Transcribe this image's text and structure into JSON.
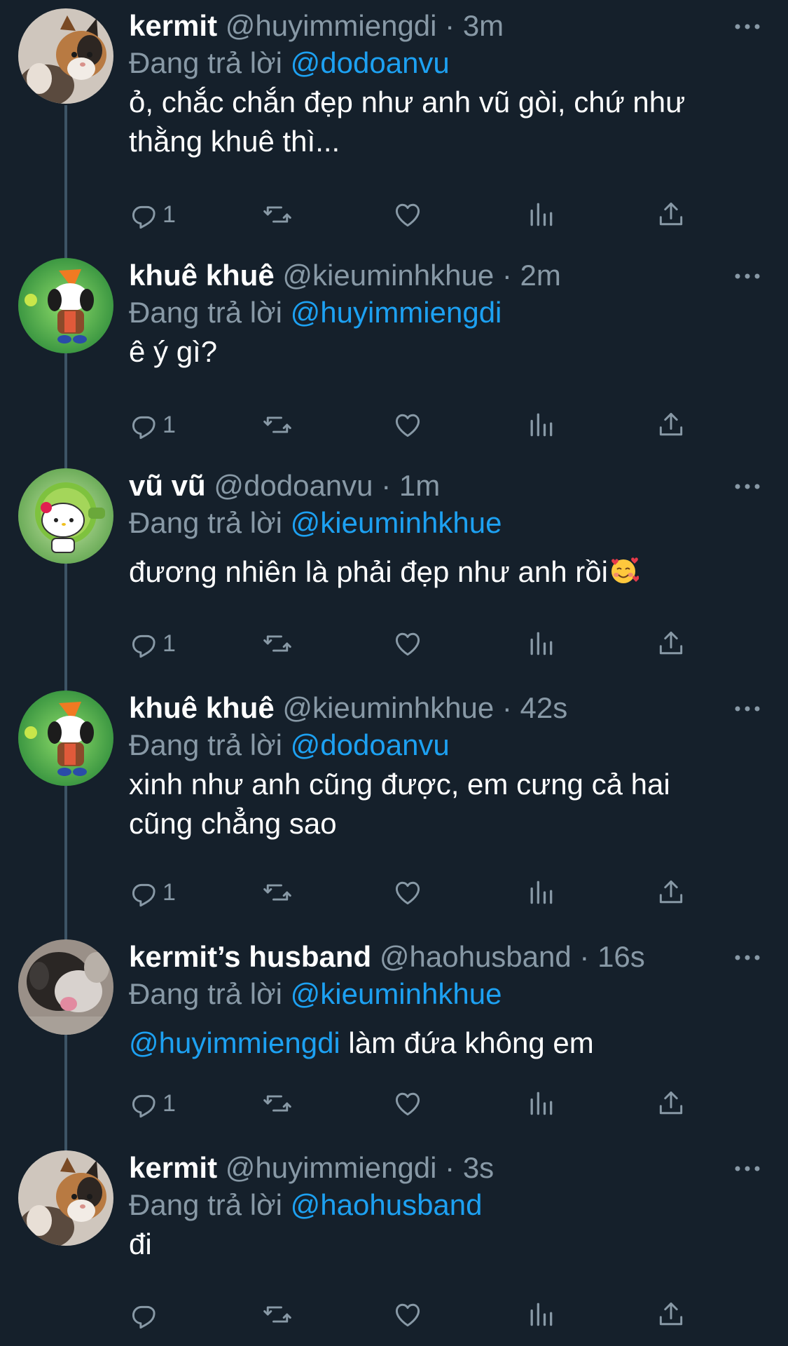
{
  "replying_prefix": "Đang trả lời",
  "colors": {
    "background": "#15202b",
    "muted": "#8899a6",
    "mention": "#1da1f2",
    "thread_line": "#3d5466"
  },
  "tweets": [
    {
      "name": "kermit",
      "handle": "@huyimmiengdi",
      "time": "· 3m",
      "reply_to": "@dodoanvu",
      "text_lines": [
        "ỏ, chắc chắn đẹp như anh vũ gòi, chứ như",
        "thằng khuê thì..."
      ],
      "reply_count": "1",
      "avatar": "cat-avatar"
    },
    {
      "name": "khuê khuê",
      "handle": "@kieuminhkhue",
      "time": "· 2m",
      "reply_to": "@huyimmiengdi",
      "text_lines": [
        "ê ý gì?"
      ],
      "reply_count": "1",
      "avatar": "pochacco-avatar"
    },
    {
      "name": "vũ vũ",
      "handle": "@dodoanvu",
      "time": "· 1m",
      "reply_to": "@kieuminhkhue",
      "text_lines": [
        "đương nhiên là phải đẹp như anh rồi"
      ],
      "emoji": "smiling-face-with-hearts",
      "reply_count": "1",
      "avatar": "hello-kitty-avatar"
    },
    {
      "name": "khuê khuê",
      "handle": "@kieuminhkhue",
      "time": "· 42s",
      "reply_to": "@dodoanvu",
      "text_lines": [
        "xinh như anh cũng được, em cưng cả hai",
        "cũng chẳng sao"
      ],
      "reply_count": "1",
      "avatar": "pochacco-avatar"
    },
    {
      "name": "kermit’s husband",
      "handle": "@haohusband",
      "time": "· 16s",
      "reply_to": "@kieuminhkhue",
      "mention_inline": "@huyimmiengdi",
      "text_lines": [
        " làm đứa không em"
      ],
      "reply_count": "1",
      "avatar": "blurry-cat-avatar"
    },
    {
      "name": "kermit",
      "handle": "@huyimmiengdi",
      "time": "· 3s",
      "reply_to": "@haohusband",
      "text_lines": [
        "đi"
      ],
      "reply_count": "",
      "avatar": "cat-avatar"
    }
  ]
}
